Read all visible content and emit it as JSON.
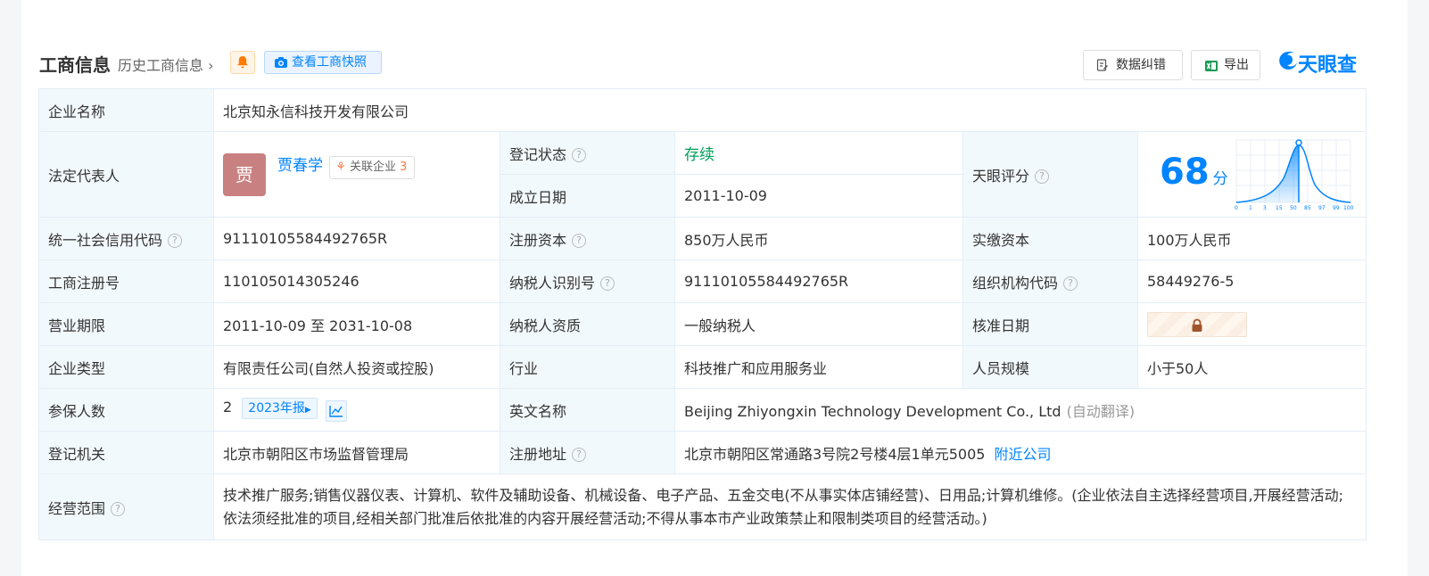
{
  "header": {
    "title": "工商信息",
    "history": "历史工商信息",
    "snapshot_button": "查看工商快照",
    "correct_button": "数据纠错",
    "export_button": "导出",
    "logo_text": "天眼查"
  },
  "labels": {
    "company_name": "企业名称",
    "legal_rep": "法定代表人",
    "reg_status": "登记状态",
    "founded": "成立日期",
    "tianyan_score": "天眼评分",
    "credit_code": "统一社会信用代码",
    "reg_capital": "注册资本",
    "paid_capital": "实缴资本",
    "reg_no": "工商注册号",
    "taxpayer_id": "纳税人识别号",
    "org_code": "组织机构代码",
    "business_term": "营业期限",
    "taxpayer_qual": "纳税人资质",
    "approval_date": "核准日期",
    "company_type": "企业类型",
    "industry": "行业",
    "staff_size": "人员规模",
    "insured": "参保人数",
    "english_name": "英文名称",
    "reg_authority": "登记机关",
    "reg_address": "注册地址",
    "business_scope": "经营范围"
  },
  "values": {
    "company_name": "北京知永信科技开发有限公司",
    "legal_rep_avatar": "贾",
    "legal_rep_name": "贾春学",
    "related_label": "关联企业",
    "related_count": "3",
    "reg_status": "存续",
    "founded": "2011-10-09",
    "score": "68",
    "score_unit": "分",
    "credit_code": "91110105584492765R",
    "reg_capital": "850万人民币",
    "paid_capital": "100万人民币",
    "reg_no": "110105014305246",
    "taxpayer_id": "91110105584492765R",
    "org_code": "58449276-5",
    "business_term": "2011-10-09 至 2031-10-08",
    "taxpayer_qual": "一般纳税人",
    "company_type": "有限责任公司(自然人投资或控股)",
    "industry": "科技推广和应用服务业",
    "staff_size": "小于50人",
    "insured": "2",
    "report_tag": "2023年报",
    "english_name": "Beijing Zhiyongxin Technology Development Co., Ltd",
    "auto_translate": "(自动翻译)",
    "reg_authority": "北京市朝阳区市场监督管理局",
    "reg_address": "北京市朝阳区常通路3号院2号楼4层1单元5005",
    "nearby": "附近公司",
    "business_scope": "技术推广服务;销售仪器仪表、计算机、软件及辅助设备、机械设备、电子产品、五金交电(不从事实体店铺经营)、日用品;计算机维修。(企业依法自主选择经营项目,开展经营活动;依法须经批准的项目,经相关部门批准后依批准的内容开展经营活动;不得从事本市产业政策禁止和限制类项目的经营活动。)"
  },
  "score_chart": {
    "ticks": [
      "0",
      "1",
      "3",
      "15",
      "50",
      "85",
      "97",
      "99",
      "100"
    ]
  },
  "colors": {
    "accent": "#0084ff",
    "status_green": "#00a05b",
    "label_bg": "#f2f9fc",
    "avatar": "#c98080",
    "related_orange": "#ff7a45"
  }
}
